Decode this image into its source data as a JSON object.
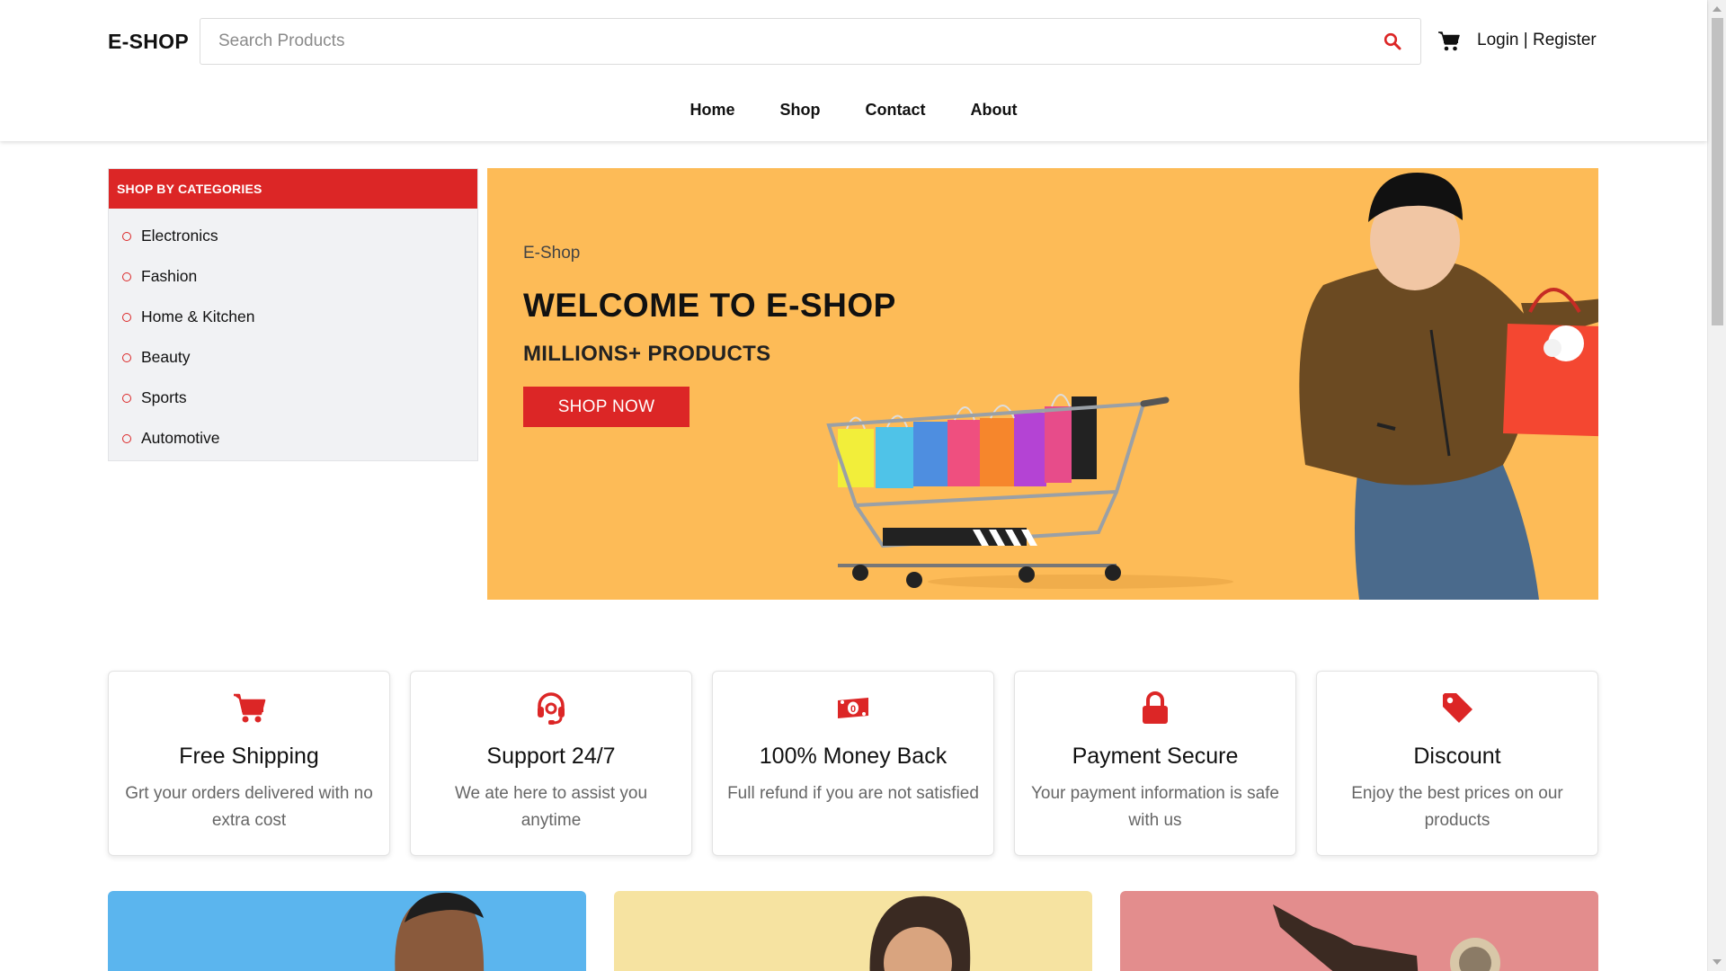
{
  "header": {
    "logo": "E-SHOP",
    "search_placeholder": "Search Products",
    "search_icon": "search-icon",
    "cart_icon": "cart-icon",
    "login_label": "Login",
    "separator": "|",
    "register_label": "Register"
  },
  "nav": {
    "items": [
      {
        "label": "Home"
      },
      {
        "label": "Shop"
      },
      {
        "label": "Contact"
      },
      {
        "label": "About"
      }
    ]
  },
  "categories": {
    "title": "SHOP BY CATEGORIES",
    "items": [
      {
        "label": "Electronics"
      },
      {
        "label": "Fashion"
      },
      {
        "label": "Home & Kitchen"
      },
      {
        "label": "Beauty"
      },
      {
        "label": "Sports"
      },
      {
        "label": "Automotive"
      }
    ]
  },
  "hero": {
    "eyebrow": "E-Shop",
    "title": "WELCOME TO E-SHOP",
    "subtitle": "MILLIONS+ PRODUCTS",
    "button_label": "SHOP NOW",
    "background_color": "#fdbb57"
  },
  "features": [
    {
      "icon": "cart-icon",
      "title": "Free Shipping",
      "desc": "Grt your orders delivered with no extra cost"
    },
    {
      "icon": "headset-icon",
      "title": "Support 24/7",
      "desc": "We ate here to assist you anytime"
    },
    {
      "icon": "money-icon",
      "title": "100% Money Back",
      "desc": "Full refund if you are not satisfied"
    },
    {
      "icon": "lock-icon",
      "title": "Payment Secure",
      "desc": "Your payment information is safe with us"
    },
    {
      "icon": "tag-icon",
      "title": "Discount",
      "desc": "Enjoy the best prices on our products"
    }
  ],
  "promos": [
    {
      "color": "#5bb5ee"
    },
    {
      "color": "#f6e3a1"
    },
    {
      "color": "#e38d8d"
    }
  ],
  "colors": {
    "accent": "#dc2626",
    "hero_bg": "#fdbb57",
    "category_bg": "#f1f2f4"
  }
}
